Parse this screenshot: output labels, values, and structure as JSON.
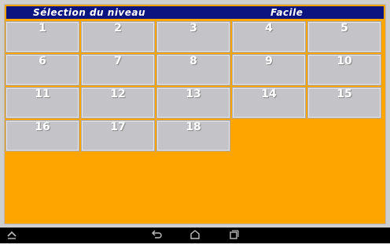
{
  "header": {
    "title": "Sélection du niveau",
    "difficulty": "Facile"
  },
  "levels": [
    "1",
    "2",
    "3",
    "4",
    "5",
    "6",
    "7",
    "8",
    "9",
    "10",
    "11",
    "12",
    "13",
    "14",
    "15",
    "16",
    "17",
    "18"
  ],
  "colors": {
    "background": "#ffa500",
    "header": "#0c1480",
    "button": "#c3c3c8",
    "navbar": "#000000"
  },
  "navbar": {
    "icons": [
      "chevron-up-icon",
      "back-icon",
      "home-icon",
      "recents-icon"
    ]
  }
}
